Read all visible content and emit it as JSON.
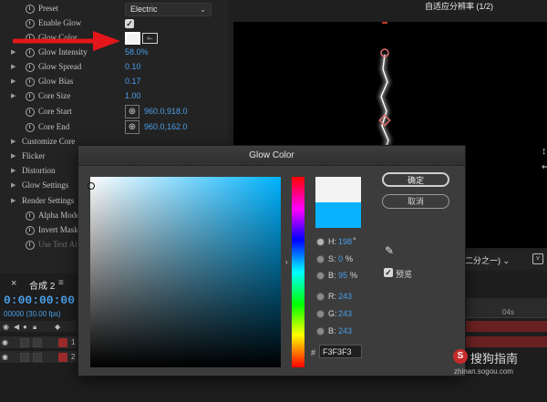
{
  "effect_controls": {
    "rows": [
      {
        "label": "Preset",
        "kind": "dropdown",
        "value": "Electric",
        "stopwatch": true
      },
      {
        "label": "Enable Glow",
        "kind": "checkbox",
        "stopwatch": true
      },
      {
        "label": "Glow Color",
        "kind": "color",
        "stopwatch": true
      },
      {
        "label": "Glow Intensity",
        "kind": "value",
        "value": "58.0%",
        "stopwatch": true,
        "expand": true
      },
      {
        "label": "Glow Spread",
        "kind": "value",
        "value": "0.10",
        "stopwatch": true,
        "expand": true
      },
      {
        "label": "Glow Bias",
        "kind": "value",
        "value": "0.17",
        "stopwatch": true,
        "expand": true
      },
      {
        "label": "Core Size",
        "kind": "value",
        "value": "1.00",
        "stopwatch": true,
        "expand": true
      },
      {
        "label": "Core Start",
        "kind": "point",
        "value": "960.0,918.0",
        "stopwatch": true
      },
      {
        "label": "Core End",
        "kind": "point",
        "value": "960.0,162.0",
        "stopwatch": true
      },
      {
        "label": "Customize Core",
        "kind": "group",
        "expand": true
      },
      {
        "label": "Flicker",
        "kind": "group",
        "expand": true
      },
      {
        "label": "Distortion",
        "kind": "group",
        "expand": true
      },
      {
        "label": "Glow Settings",
        "kind": "group",
        "expand": true
      },
      {
        "label": "Render Settings",
        "kind": "group",
        "expand": true
      },
      {
        "label": "Alpha Mode",
        "kind": "sub",
        "stopwatch": true
      },
      {
        "label": "Invert Mask",
        "kind": "sub",
        "stopwatch": true
      },
      {
        "label": "Use Text Al",
        "kind": "sub",
        "stopwatch": true,
        "disabled": true
      }
    ]
  },
  "viewer": {
    "title": "自适应分辨率 (1/2)",
    "resolution": "二分之一)",
    "resolution_icon": "v"
  },
  "timeline": {
    "comp_tab": "合成 2",
    "timecode": "0:00:00:00",
    "framecode": "00000 (30.00 fps)",
    "ruler_label": "04s",
    "layers": [
      {
        "number": "1"
      },
      {
        "number": "2"
      }
    ]
  },
  "dialog": {
    "title": "Glow Color",
    "ok_label": "确定",
    "cancel_label": "取消",
    "preview_label": "预览",
    "hex_value": "F3F3F3",
    "hsb": [
      {
        "label": "H:",
        "value": "198",
        "unit": "°"
      },
      {
        "label": "S:",
        "value": "0",
        "unit": "%"
      },
      {
        "label": "B:",
        "value": "95",
        "unit": "%"
      }
    ],
    "rgb": [
      {
        "label": "R:",
        "value": "243"
      },
      {
        "label": "G:",
        "value": "243"
      },
      {
        "label": "B:",
        "value": "243"
      }
    ],
    "new_color": "#F3F3F3",
    "current_color": "#08B2FF",
    "hue_color": "#00B2FF"
  },
  "watermark": {
    "icon": "S",
    "text": "搜狗指南",
    "url": "zhinan.sogou.com"
  },
  "colors": {
    "accent_blue": "#4A9EE8",
    "arrow_red": "#E3171B",
    "layer_red": "#9C2B2B"
  }
}
